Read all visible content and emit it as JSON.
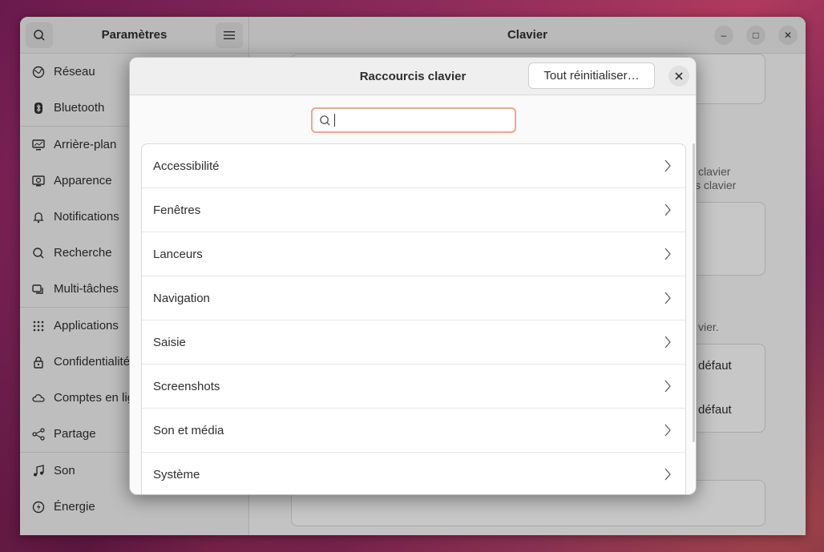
{
  "sidebar": {
    "title": "Paramètres",
    "search_icon": "search-icon",
    "menu_icon": "hamburger-menu-icon",
    "items": [
      {
        "label": "Réseau",
        "icon": "globe-icon"
      },
      {
        "label": "Bluetooth",
        "icon": "bluetooth-icon"
      },
      {
        "label": "Arrière-plan",
        "icon": "monitor-icon"
      },
      {
        "label": "Apparence",
        "icon": "appearance-icon"
      },
      {
        "label": "Notifications",
        "icon": "bell-icon"
      },
      {
        "label": "Recherche",
        "icon": "search-icon"
      },
      {
        "label": "Multi-tâches",
        "icon": "multitask-icon"
      },
      {
        "label": "Applications",
        "icon": "grid-icon"
      },
      {
        "label": "Confidentialité",
        "icon": "lock-icon"
      },
      {
        "label": "Comptes en ligne",
        "icon": "cloud-icon"
      },
      {
        "label": "Partage",
        "icon": "share-icon"
      },
      {
        "label": "Son",
        "icon": "music-note-icon"
      },
      {
        "label": "Énergie",
        "icon": "power-icon"
      }
    ]
  },
  "content": {
    "title": "Clavier",
    "text_1": "clavier",
    "text_2": "s clavier",
    "text_3": "vier.",
    "default_1": "défaut",
    "default_2": "défaut"
  },
  "window_controls": {
    "minimize": "–",
    "maximize": "□",
    "close": "✕"
  },
  "dialog": {
    "title": "Raccourcis clavier",
    "reset_label": "Tout réinitialiser…",
    "search_placeholder": "",
    "categories": [
      {
        "label": "Accessibilité"
      },
      {
        "label": "Fenêtres"
      },
      {
        "label": "Lanceurs"
      },
      {
        "label": "Navigation"
      },
      {
        "label": "Saisie"
      },
      {
        "label": "Screenshots"
      },
      {
        "label": "Son et média"
      },
      {
        "label": "Système"
      }
    ]
  },
  "colors": {
    "accent": "#f0a68a",
    "window_bg": "#fafafa",
    "header_bg": "#efefef"
  }
}
